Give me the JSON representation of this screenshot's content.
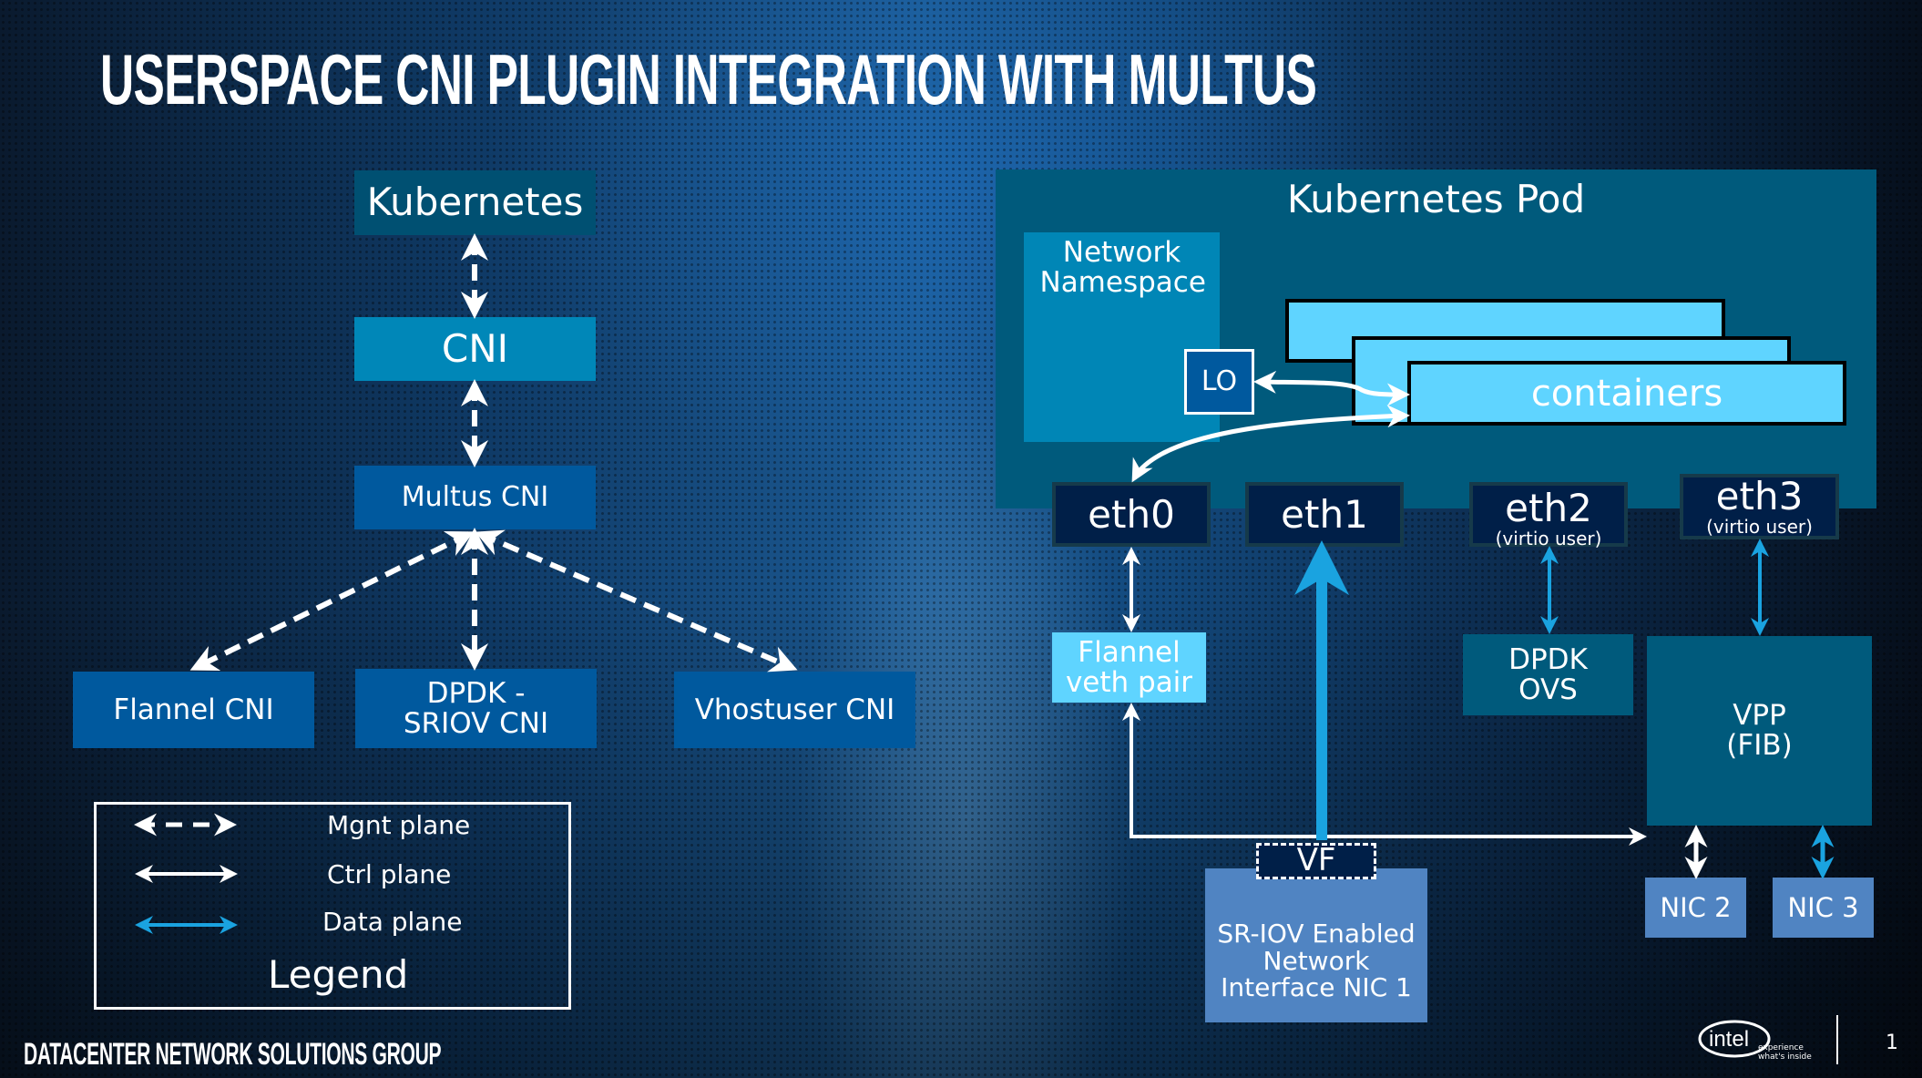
{
  "title": "USERSPACE CNI PLUGIN INTEGRATION WITH MULTUS",
  "left_stack": {
    "kubernetes": "Kubernetes",
    "cni": "CNI",
    "multus": "Multus CNI",
    "plugins": [
      "Flannel CNI",
      "DPDK - SRIOV CNI",
      "Vhostuser CNI"
    ]
  },
  "legend": {
    "title": "Legend",
    "items": [
      {
        "label": "Mgnt plane",
        "style": "dashed",
        "color": "#ffffff"
      },
      {
        "label": "Ctrl plane",
        "style": "solid",
        "color": "#ffffff"
      },
      {
        "label": "Data plane",
        "style": "solid",
        "color": "#1aa3e0"
      }
    ]
  },
  "pod": {
    "title": "Kubernetes Pod",
    "namespace": "Network Namespace",
    "loopback": "LO",
    "containers": "containers",
    "interfaces": [
      {
        "name": "eth0",
        "sub": ""
      },
      {
        "name": "eth1",
        "sub": ""
      },
      {
        "name": "eth2",
        "sub": "(virtio user)"
      },
      {
        "name": "eth3",
        "sub": "(virtio user)"
      }
    ]
  },
  "dataplane": {
    "flannel_veth": "Flannel veth pair",
    "dpdk_ovs": "DPDK OVS",
    "vpp": "VPP (FIB)",
    "vf": "VF",
    "sriov_nic": "SR-IOV Enabled Network Interface NIC 1",
    "nic2": "NIC 2",
    "nic3": "NIC 3"
  },
  "colors": {
    "data_plane": "#1aa3e0",
    "pod_bg": "#005a7c",
    "container": "#5fd4ff",
    "nic": "#5084c2",
    "interface": "#001f48"
  },
  "footer": {
    "group": "DATACENTER NETWORK SOLUTIONS GROUP",
    "brand": "intel",
    "tagline": "experience what's inside",
    "page": "1"
  }
}
